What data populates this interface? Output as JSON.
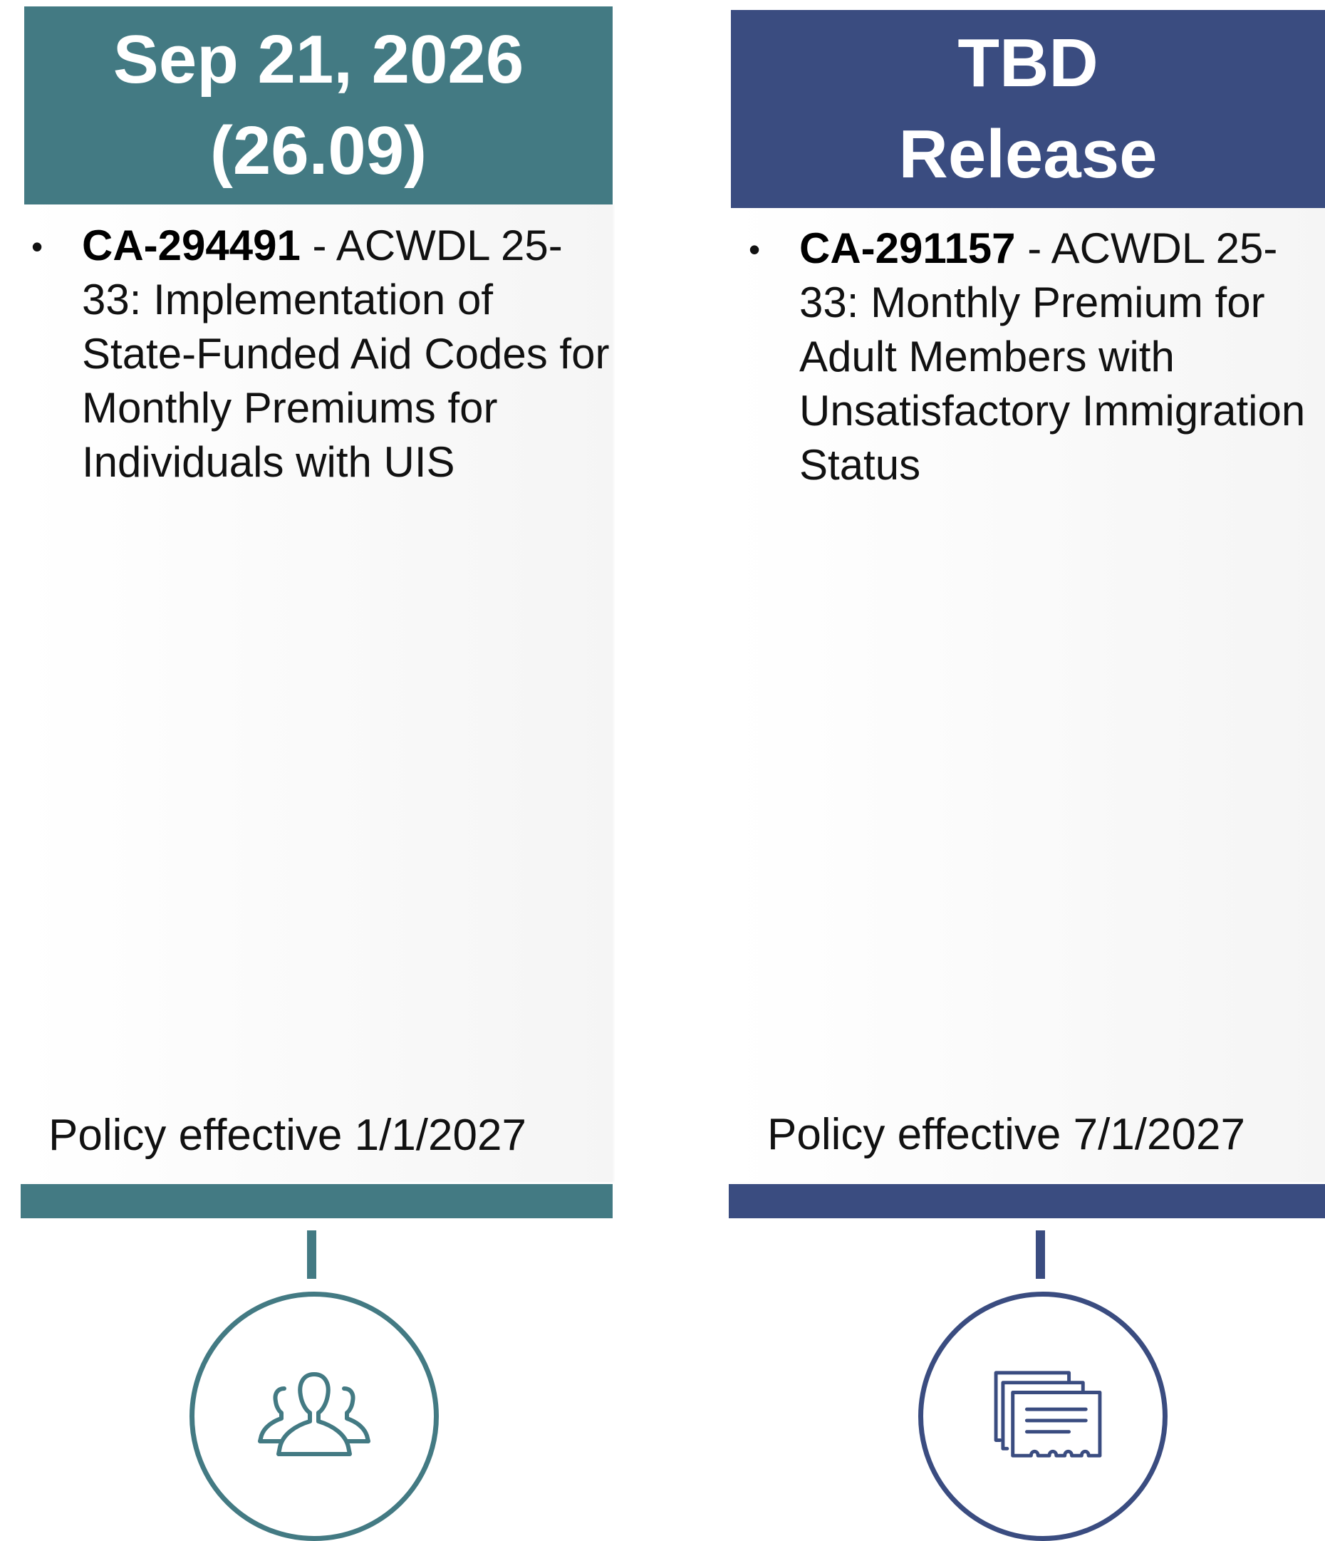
{
  "colors": {
    "teal": "#437a83",
    "navy": "#3a4c80",
    "text": "#111111"
  },
  "cards": [
    {
      "header_line1": "Sep 21, 2026",
      "header_line2": "(26.09)",
      "item_id": "CA-294491",
      "item_separator": " - ",
      "item_text": "ACWDL 25-33: Implementation of State-Funded Aid Codes for Monthly Premiums for Individuals with UIS",
      "policy": "Policy effective 1/1/2027",
      "icon": "people-group-icon"
    },
    {
      "header_line1": "TBD",
      "header_line2": "Release",
      "item_id": "CA-291157",
      "item_separator": " - ",
      "item_text": "ACWDL 25-33: Monthly Premium for Adult Members with Unsatisfactory Immigration Status",
      "policy": "Policy effective 7/1/2027",
      "icon": "documents-stack-icon"
    }
  ]
}
